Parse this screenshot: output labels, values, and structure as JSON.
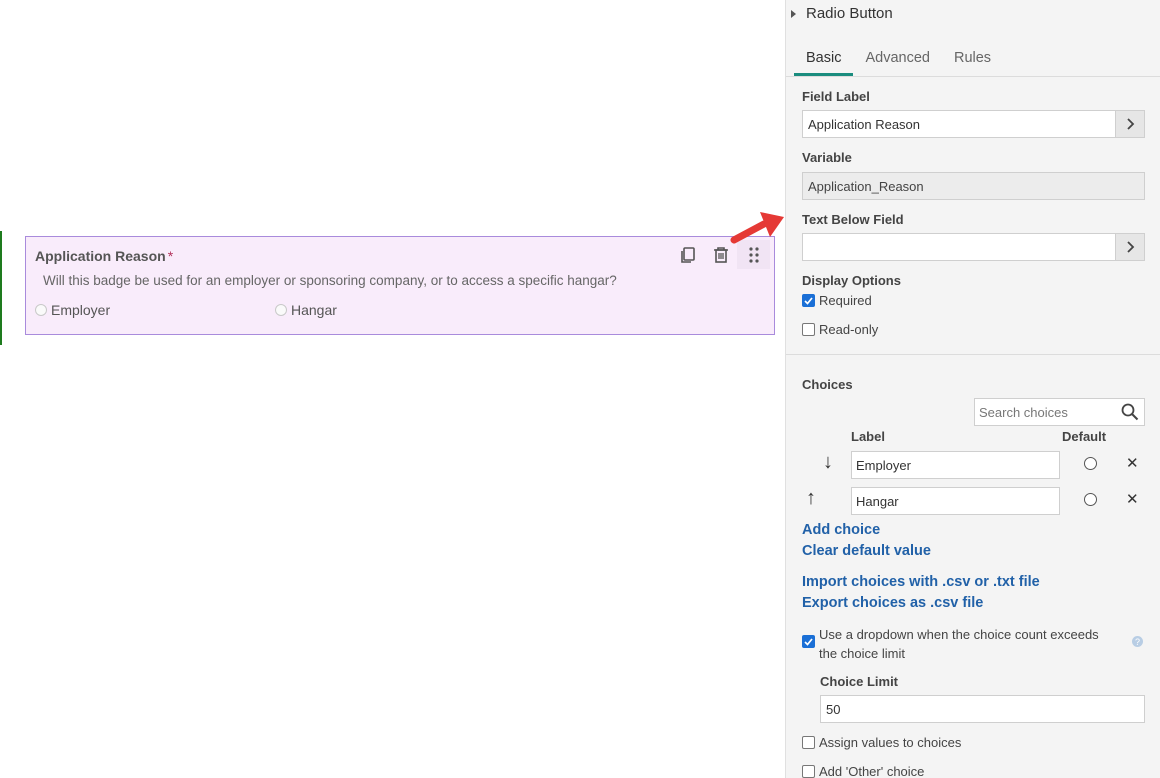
{
  "canvas": {
    "field": {
      "title": "Application Reason",
      "required_marker": "*",
      "description": "Will this badge be used for an employer or sponsoring company, or to access a specific hangar?",
      "options": [
        "Employer",
        "Hangar"
      ],
      "tool_icons": [
        "copy-icon",
        "trash-icon",
        "drag-handle-icon"
      ]
    },
    "colors": {
      "card_bg": "#f9ecfb",
      "card_border": "#a98bdc",
      "selection_bar": "#1e7b1e",
      "arrow": "#e53935"
    }
  },
  "panel": {
    "title": "Radio Button",
    "tabs": [
      {
        "label": "Basic",
        "active": true
      },
      {
        "label": "Advanced",
        "active": false
      },
      {
        "label": "Rules",
        "active": false
      }
    ],
    "field_label": {
      "label": "Field Label",
      "value": "Application Reason"
    },
    "variable": {
      "label": "Variable",
      "value": "Application_Reason"
    },
    "text_below": {
      "label": "Text Below Field",
      "value": ""
    },
    "display_options": {
      "label": "Display Options",
      "required": {
        "label": "Required",
        "checked": true
      },
      "readonly": {
        "label": "Read-only",
        "checked": false
      }
    },
    "choices": {
      "label": "Choices",
      "search_placeholder": "Search choices",
      "col_label": "Label",
      "col_default": "Default",
      "rows": [
        {
          "label": "Employer",
          "arrow": "↓"
        },
        {
          "label": "Hangar",
          "arrow": "↑"
        }
      ],
      "add_choice": "Add choice",
      "clear_default": "Clear default value",
      "import": "Import choices with .csv or .txt file",
      "export": "Export choices as .csv file",
      "dropdown_option": {
        "line1": "Use a dropdown when the choice count exceeds",
        "line2": "the choice limit",
        "checked": true
      },
      "choice_limit": {
        "label": "Choice Limit",
        "value": "50"
      },
      "assign_values": {
        "label": "Assign values to choices",
        "checked": false
      },
      "other_choice": {
        "label": "Add 'Other' choice",
        "checked": false
      }
    },
    "colors": {
      "accent_tab": "#1a8c7e",
      "link": "#2161a8",
      "checkbox": "#1a6fd6"
    }
  }
}
